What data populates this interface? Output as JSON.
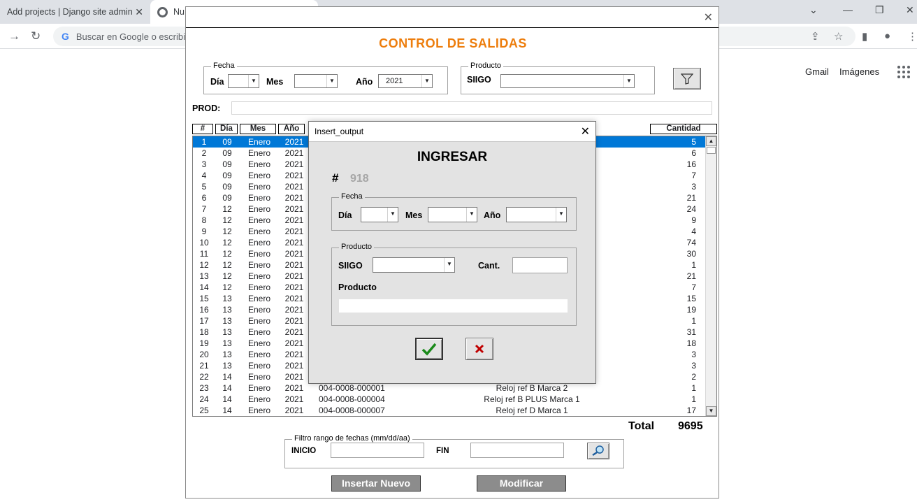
{
  "browser": {
    "tab1_title": "Add projects | Django site admin",
    "tab2_title": "Nu",
    "omnibox_placeholder": "Buscar en Google o escribir una URL",
    "gmail": "Gmail",
    "imagenes": "Imágenes"
  },
  "main": {
    "title": "CONTROL DE SALIDAS",
    "fecha_frame": "Fecha",
    "dia_label": "Día",
    "mes_label": "Mes",
    "anio_label": "Año",
    "anio_value": "2021",
    "producto_frame": "Producto",
    "siigo_label": "SIIGO",
    "prod_label": "PROD:",
    "headers": {
      "num": "#",
      "dia": "Día",
      "mes": "Mes",
      "anio": "Año",
      "cantidad": "Cantidad"
    },
    "rows": [
      {
        "n": "1",
        "d": "09",
        "m": "Enero",
        "y": "2021",
        "code": "",
        "prod": "",
        "q": "5"
      },
      {
        "n": "2",
        "d": "09",
        "m": "Enero",
        "y": "2021",
        "code": "",
        "prod": "",
        "q": "6"
      },
      {
        "n": "3",
        "d": "09",
        "m": "Enero",
        "y": "2021",
        "code": "",
        "prod": "",
        "q": "16"
      },
      {
        "n": "4",
        "d": "09",
        "m": "Enero",
        "y": "2021",
        "code": "",
        "prod": "",
        "q": "7"
      },
      {
        "n": "5",
        "d": "09",
        "m": "Enero",
        "y": "2021",
        "code": "",
        "prod": "",
        "q": "3"
      },
      {
        "n": "6",
        "d": "09",
        "m": "Enero",
        "y": "2021",
        "code": "",
        "prod": "",
        "q": "21"
      },
      {
        "n": "7",
        "d": "12",
        "m": "Enero",
        "y": "2021",
        "code": "",
        "prod": "",
        "q": "24"
      },
      {
        "n": "8",
        "d": "12",
        "m": "Enero",
        "y": "2021",
        "code": "",
        "prod": "",
        "q": "9"
      },
      {
        "n": "9",
        "d": "12",
        "m": "Enero",
        "y": "2021",
        "code": "",
        "prod": "",
        "q": "4"
      },
      {
        "n": "10",
        "d": "12",
        "m": "Enero",
        "y": "2021",
        "code": "",
        "prod": "",
        "q": "74"
      },
      {
        "n": "11",
        "d": "12",
        "m": "Enero",
        "y": "2021",
        "code": "",
        "prod": "",
        "q": "30"
      },
      {
        "n": "12",
        "d": "12",
        "m": "Enero",
        "y": "2021",
        "code": "",
        "prod": "",
        "q": "1"
      },
      {
        "n": "13",
        "d": "12",
        "m": "Enero",
        "y": "2021",
        "code": "",
        "prod": "",
        "q": "21"
      },
      {
        "n": "14",
        "d": "12",
        "m": "Enero",
        "y": "2021",
        "code": "",
        "prod": "",
        "q": "7"
      },
      {
        "n": "15",
        "d": "13",
        "m": "Enero",
        "y": "2021",
        "code": "",
        "prod": "",
        "q": "15"
      },
      {
        "n": "16",
        "d": "13",
        "m": "Enero",
        "y": "2021",
        "code": "",
        "prod": "",
        "q": "19"
      },
      {
        "n": "17",
        "d": "13",
        "m": "Enero",
        "y": "2021",
        "code": "",
        "prod": "",
        "q": "1"
      },
      {
        "n": "18",
        "d": "13",
        "m": "Enero",
        "y": "2021",
        "code": "",
        "prod": "",
        "q": "31"
      },
      {
        "n": "19",
        "d": "13",
        "m": "Enero",
        "y": "2021",
        "code": "",
        "prod": "",
        "q": "18"
      },
      {
        "n": "20",
        "d": "13",
        "m": "Enero",
        "y": "2021",
        "code": "",
        "prod": "",
        "q": "3"
      },
      {
        "n": "21",
        "d": "13",
        "m": "Enero",
        "y": "2021",
        "code": "",
        "prod": "",
        "q": "3"
      },
      {
        "n": "22",
        "d": "14",
        "m": "Enero",
        "y": "2021",
        "code": "",
        "prod": "",
        "q": "2"
      },
      {
        "n": "23",
        "d": "14",
        "m": "Enero",
        "y": "2021",
        "code": "004-0008-000001",
        "prod": "Reloj ref B Marca 2",
        "q": "1"
      },
      {
        "n": "24",
        "d": "14",
        "m": "Enero",
        "y": "2021",
        "code": "004-0008-000004",
        "prod": "Reloj ref B PLUS Marca 1",
        "q": "1"
      },
      {
        "n": "25",
        "d": "14",
        "m": "Enero",
        "y": "2021",
        "code": "004-0008-000007",
        "prod": "Reloj ref D Marca 1",
        "q": "17"
      }
    ],
    "total_label": "Total",
    "total_value": "9695",
    "filtro_frame": "Filtro rango de fechas (mm/dd/aa)",
    "inicio_label": "INICIO",
    "fin_label": "FIN",
    "insertar_label": "Insertar Nuevo",
    "modificar_label": "Modificar"
  },
  "modal": {
    "window_title": "Insert_output",
    "heading": "INGRESAR",
    "hash": "#",
    "id_value": "918",
    "fecha_frame": "Fecha",
    "dia_label": "Día",
    "mes_label": "Mes",
    "anio_label": "Año",
    "producto_frame": "Producto",
    "siigo_label": "SIIGO",
    "cant_label": "Cant.",
    "producto_label": "Producto"
  },
  "colors": {
    "title_orange": "#ed7d0c",
    "selection_blue": "#0078d7",
    "ok_green": "#1a8a1a",
    "cancel_red": "#c00000"
  }
}
